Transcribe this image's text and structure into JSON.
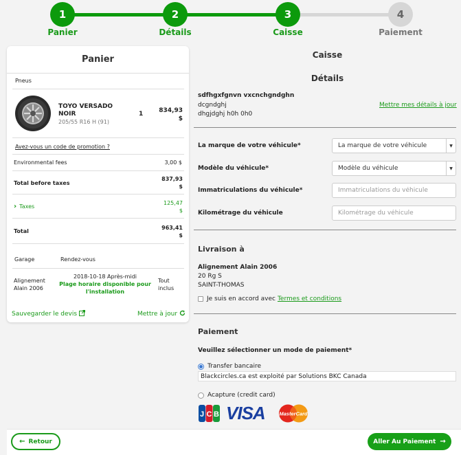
{
  "stepper": {
    "steps": [
      {
        "number": "1",
        "label": "Panier"
      },
      {
        "number": "2",
        "label": "Détails"
      },
      {
        "number": "3",
        "label": "Caisse"
      },
      {
        "number": "4",
        "label": "Paiement"
      }
    ],
    "active_color": "#0c9a0c",
    "inactive_color": "#d6d6d6"
  },
  "cart": {
    "title": "Panier",
    "category": "Pneus",
    "product": {
      "name_line1": "TOYO VERSADO",
      "name_line2": "NOIR",
      "size": "205/55 R16 H (91)",
      "quantity": "1",
      "price": "834,93",
      "currency": "$"
    },
    "promo_link": "Avez-vous un code de promotion ?",
    "env_fees_label": "Environmental fees",
    "env_fees_value": "3,00 $",
    "total_before_taxes_label": "Total before taxes",
    "total_before_taxes_value": "837,93",
    "total_before_taxes_currency": "$",
    "taxes_label": "Taxes",
    "taxes_value": "125,47",
    "taxes_currency": "$",
    "total_label": "Total",
    "total_value": "963,41",
    "total_currency": "$",
    "garage_header": "Garage",
    "rendezvous_header": "Rendez-vous",
    "garage_name_line1": "Alignement",
    "garage_name_line2": "Alain 2006",
    "appointment_date": "2018-10-18 Après-midi",
    "appointment_note_line1": "Plage horaire disponible pour",
    "appointment_note_line2": "l'installation",
    "included_line1": "Tout",
    "included_line2": "inclus",
    "save_quote": "Sauvegarder le devis",
    "update": "Mettre à jour"
  },
  "checkout": {
    "title": "Caisse",
    "details_title": "Détails",
    "customer_name": "sdfhgxfgnvn vxcnchgndghn",
    "customer_line2": "dcgndghj",
    "customer_line3": "dhgjdghj h0h 0h0",
    "update_details_link": "Mettre mes détails à jour",
    "vehicle_brand_label": "La marque de votre véhicule*",
    "vehicle_brand_value": "La marque de votre véhicule",
    "vehicle_model_label": "Modèle du véhicule*",
    "vehicle_model_value": "Modèle du véhicule",
    "registration_label": "Immatriculations du véhicule*",
    "registration_placeholder": "Immatriculations du véhicule",
    "mileage_label": "Kilométrage du véhicule",
    "mileage_placeholder": "Kilométrage du véhicule",
    "delivery_title": "Livraison à",
    "delivery_name": "Alignement Alain 2006",
    "delivery_street": "20 Rg S",
    "delivery_city": "SAINT-THOMAS",
    "terms_prefix": "Je suis en accord avec",
    "terms_link": "Termes et conditions",
    "payment_title": "Paiement",
    "payment_prompt": "Veuillez sélectionner un mode de paiement*",
    "payment_option1": "Transfer bancaire",
    "payment_option1_note": "Blackcircles.ca est exploité par Solutions BKC Canada",
    "payment_option2": "Acapture (credit card)",
    "card_brands": [
      "JCB",
      "VISA",
      "MasterCard"
    ]
  },
  "footer": {
    "back": "Retour",
    "next": "Aller Au Paiement"
  }
}
